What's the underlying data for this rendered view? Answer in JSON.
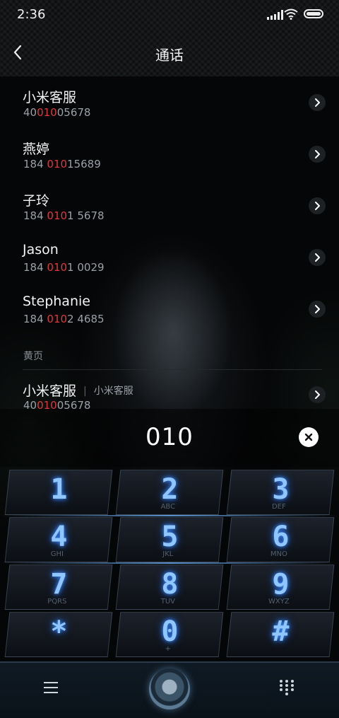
{
  "status": {
    "time": "2:36"
  },
  "header": {
    "title": "通话"
  },
  "contacts": [
    {
      "name": "小米客服",
      "number_pre": "40",
      "number_hl": "010",
      "number_post": "05678"
    },
    {
      "name": "燕婷",
      "number_pre": "184 ",
      "number_hl": "010",
      "number_post": "15689"
    },
    {
      "name": "子玲",
      "number_pre": "184 ",
      "number_hl": "010",
      "number_post": "1 5678"
    },
    {
      "name": "Jason",
      "number_pre": "184 ",
      "number_hl": "010",
      "number_post": "1 0029"
    },
    {
      "name": "Stephanie",
      "number_pre": "184 ",
      "number_hl": "010",
      "number_post": "2 4685"
    }
  ],
  "yellow_pages": {
    "section_label": "黄页",
    "name": "小米客服",
    "separator": "|",
    "sub": "小米客服",
    "number_pre": "40",
    "number_hl": "010",
    "number_post": "05678"
  },
  "dialer": {
    "input": "010"
  },
  "keypad": [
    {
      "digit": "1",
      "letters": ""
    },
    {
      "digit": "2",
      "letters": "ABC"
    },
    {
      "digit": "3",
      "letters": "DEF"
    },
    {
      "digit": "4",
      "letters": "GHI"
    },
    {
      "digit": "5",
      "letters": "JKL"
    },
    {
      "digit": "6",
      "letters": "MNO"
    },
    {
      "digit": "7",
      "letters": "PQRS"
    },
    {
      "digit": "8",
      "letters": "TUV"
    },
    {
      "digit": "9",
      "letters": "WXYZ"
    },
    {
      "digit": "*",
      "letters": ""
    },
    {
      "digit": "0",
      "letters": "+"
    },
    {
      "digit": "#",
      "letters": ""
    }
  ],
  "icons": {
    "back": "chevron-left-icon",
    "chevron": "chevron-right-icon",
    "clear": "close-icon",
    "menu": "menu-icon",
    "call": "call-icon",
    "keypad": "keypad-icon"
  }
}
